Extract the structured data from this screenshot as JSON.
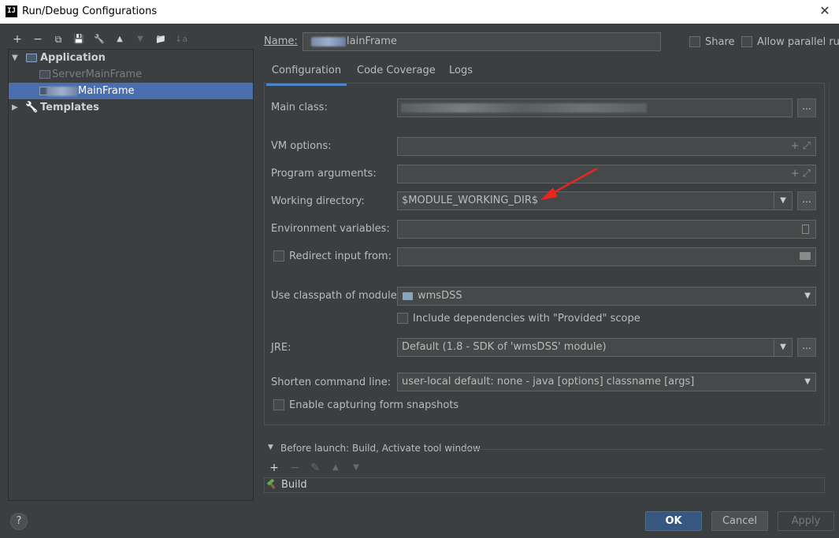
{
  "window": {
    "logo": "IJ",
    "title": "Run/Debug Configurations",
    "close_glyph": "✕"
  },
  "toolbar": {
    "add": "+",
    "remove": "−",
    "copy": "⧉",
    "save": "💾",
    "edit_defaults": "🔧",
    "move_up": "▲",
    "move_down": "▼",
    "folder": "📁",
    "sort": "↓a"
  },
  "tree": {
    "group_application": "Application",
    "item_server": "ServerMainFrame",
    "item_selected_suffix": "MainFrame",
    "group_templates": "Templates"
  },
  "header": {
    "name_label": "Name:",
    "name_value_suffix": "lainFrame",
    "share_label": "Share",
    "parallel_label": "Allow parallel run"
  },
  "tabs": [
    "Configuration",
    "Code Coverage",
    "Logs"
  ],
  "form": {
    "main_class_label": "Main class:",
    "vm_options_label": "VM options:",
    "program_args_label": "Program arguments:",
    "working_dir_label": "Working directory:",
    "working_dir_value": "$MODULE_WORKING_DIR$",
    "env_vars_label": "Environment variables:",
    "redirect_label": "Redirect input from:",
    "classpath_label": "Use classpath of module:",
    "classpath_value": "wmsDSS",
    "include_deps_label": "Include dependencies with \"Provided\" scope",
    "jre_label": "JRE:",
    "jre_value": "Default (1.8 - SDK of 'wmsDSS' module)",
    "shorten_label": "Shorten command line:",
    "shorten_value": "user-local default: none - java [options] classname [args]",
    "snapshots_label": "Enable capturing form snapshots",
    "browse": "...",
    "expand_glyph": "+ ⤢",
    "dropdown_glyph": "▼"
  },
  "before_launch": {
    "title": "Before launch: Build, Activate tool window",
    "add": "+",
    "remove": "−",
    "edit": "✎",
    "up": "▲",
    "down": "▼",
    "task_build": "Build"
  },
  "buttons": {
    "help": "?",
    "ok": "OK",
    "cancel": "Cancel",
    "apply": "Apply"
  },
  "colors": {
    "accent": "#4b6eaf",
    "tab_underline": "#4a88c7",
    "ok_button": "#365880",
    "annotation_arrow": "#e8261f"
  }
}
